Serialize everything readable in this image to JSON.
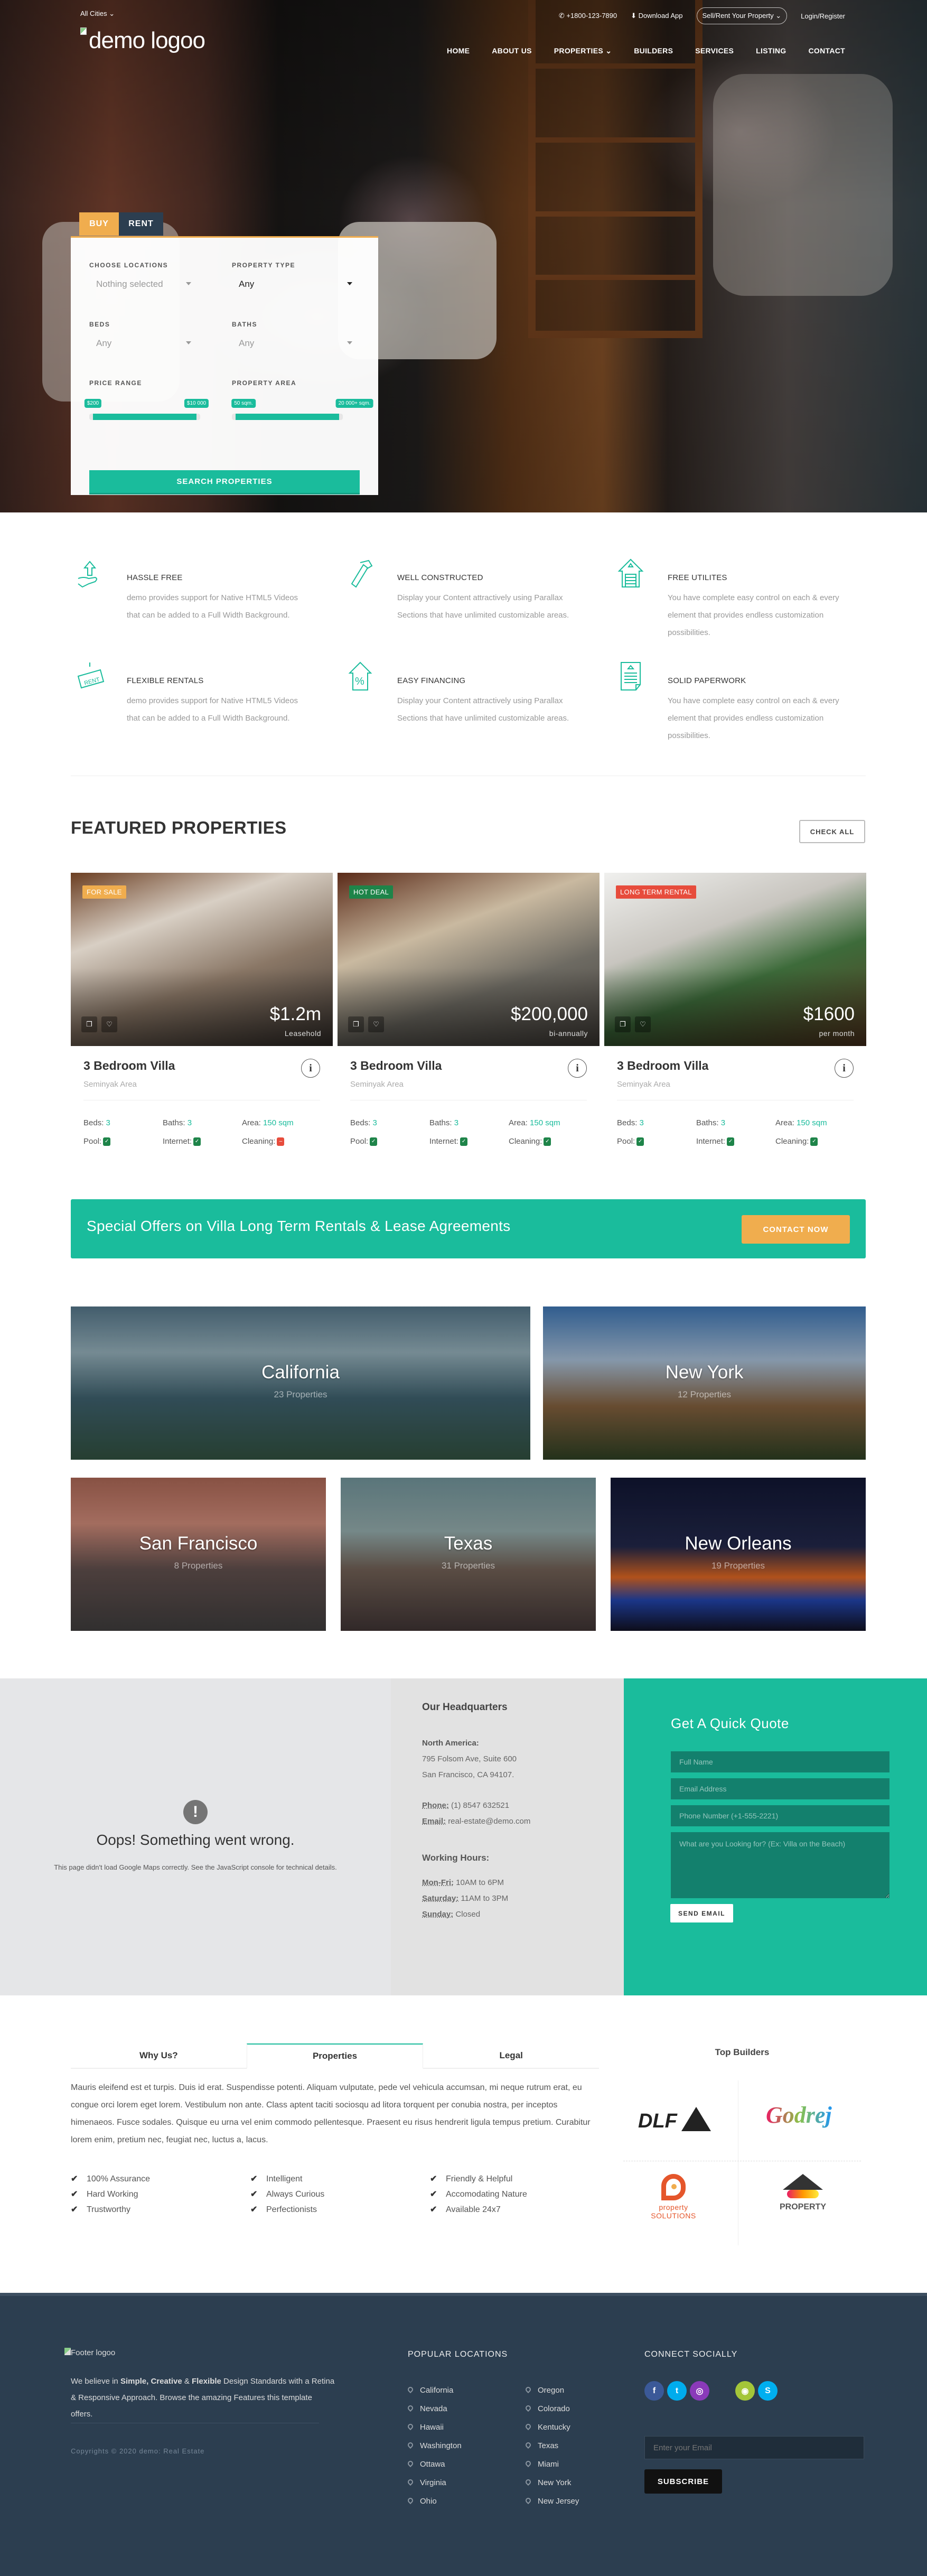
{
  "topbar": {
    "cities": "All Cities",
    "phone": "+1800-123-7890",
    "download": "Download App",
    "sell_rent": "Sell/Rent Your Property",
    "login": "Login/Register"
  },
  "logo": "demo logoo",
  "nav": [
    "HOME",
    "ABOUT US",
    "PROPERTIES",
    "BUILDERS",
    "SERVICES",
    "LISTING",
    "CONTACT"
  ],
  "search": {
    "tabs": [
      "BUY",
      "RENT"
    ],
    "active_tab": "BUY",
    "location_label": "CHOOSE LOCATIONS",
    "location_value": "Nothing selected",
    "type_label": "PROPERTY TYPE",
    "type_value": "Any",
    "beds_label": "BEDS",
    "beds_value": "Any",
    "baths_label": "BATHS",
    "baths_value": "Any",
    "price_label": "PRICE RANGE",
    "price_min": "$200",
    "price_max": "$10 000",
    "area_label": "PROPERTY AREA",
    "area_min": "50 sqm.",
    "area_max": "20 000+ sqm.",
    "button": "SEARCH PROPERTIES"
  },
  "features": [
    {
      "icon": "hand-house-icon",
      "title": "HASSLE FREE",
      "text": "demo provides support for Native HTML5 Videos that can be added to a Full Width Background."
    },
    {
      "icon": "hammer-icon",
      "title": "WELL CONSTRUCTED",
      "text": "Display your Content attractively using Parallax Sections that have unlimited customizable areas."
    },
    {
      "icon": "garage-house-icon",
      "title": "FREE UTILITES",
      "text": "You have complete easy control on each & every element that provides endless customization possibilities."
    },
    {
      "icon": "rent-sign-icon",
      "title": "FLEXIBLE RENTALS",
      "text": "demo provides support for Native HTML5 Videos that can be added to a Full Width Background."
    },
    {
      "icon": "percent-house-icon",
      "title": "EASY FINANCING",
      "text": "Display your Content attractively using Parallax Sections that have unlimited customizable areas."
    },
    {
      "icon": "document-icon",
      "title": "SOLID PAPERWORK",
      "text": "You have complete easy control on each & every element that provides endless customization possibilities."
    }
  ],
  "featured": {
    "title": "FEATURED PROPERTIES",
    "check_all": "CHECK ALL",
    "items": [
      {
        "badge": "FOR SALE",
        "badge_color": "#f0ad4e",
        "price": "$1.2m",
        "period": "Leasehold",
        "title": "3 Bedroom Villa",
        "location": "Seminyak Area",
        "beds_label": "Beds:",
        "beds": "3",
        "baths_label": "Baths:",
        "baths": "3",
        "area_label": "Area:",
        "area": "150 sqm",
        "pool_label": "Pool:",
        "pool": true,
        "internet_label": "Internet:",
        "internet": true,
        "cleaning_label": "Cleaning:",
        "cleaning": false
      },
      {
        "badge": "HOT DEAL",
        "badge_color": "#1e8449",
        "price": "$200,000",
        "period": "bi-annually",
        "title": "3 Bedroom Villa",
        "location": "Seminyak Area",
        "beds_label": "Beds:",
        "beds": "3",
        "baths_label": "Baths:",
        "baths": "3",
        "area_label": "Area:",
        "area": "150 sqm",
        "pool_label": "Pool:",
        "pool": true,
        "internet_label": "Internet:",
        "internet": true,
        "cleaning_label": "Cleaning:",
        "cleaning": true
      },
      {
        "badge": "LONG TERM RENTAL",
        "badge_color": "#e74c3c",
        "price": "$1600",
        "period": "per month",
        "title": "3 Bedroom Villa",
        "location": "Seminyak Area",
        "beds_label": "Beds:",
        "beds": "3",
        "baths_label": "Baths:",
        "baths": "3",
        "area_label": "Area:",
        "area": "150 sqm",
        "pool_label": "Pool:",
        "pool": true,
        "internet_label": "Internet:",
        "internet": true,
        "cleaning_label": "Cleaning:",
        "cleaning": true
      }
    ]
  },
  "banner": {
    "text": "Special Offers on Villa Long Term Rentals & Lease Agreements",
    "button": "CONTACT NOW"
  },
  "cities": [
    {
      "name": "California",
      "count": "23 Properties"
    },
    {
      "name": "New York",
      "count": "12 Properties"
    },
    {
      "name": "San Francisco",
      "count": "8 Properties"
    },
    {
      "name": "Texas",
      "count": "31 Properties"
    },
    {
      "name": "New Orleans",
      "count": "19 Properties"
    }
  ],
  "map": {
    "title": "Oops! Something went wrong.",
    "message": "This page didn't load Google Maps correctly. See the JavaScript console for technical details."
  },
  "hq": {
    "title": "Our Headquarters",
    "region": "North America:",
    "address1": "795 Folsom Ave, Suite 600",
    "address2": "San Francisco, CA 94107.",
    "phone_label": "Phone:",
    "phone": "(1) 8547 632521",
    "email_label": "Email:",
    "email": "real-estate@demo.com",
    "hours_title": "Working Hours:",
    "hours": [
      {
        "day": "Mon-Fri:",
        "time": "10AM to 6PM"
      },
      {
        "day": "Saturday:",
        "time": "11AM to 3PM"
      },
      {
        "day": "Sunday:",
        "time": "Closed"
      }
    ]
  },
  "quote": {
    "title": "Get A Quick Quote",
    "name_placeholder": "Full Name",
    "email_placeholder": "Email Address",
    "phone_placeholder": "Phone Number (+1-555-2221)",
    "message_placeholder": "What are you Looking for? (Ex: Villa on the Beach)",
    "button": "SEND EMAIL"
  },
  "about": {
    "tabs": [
      "Why Us?",
      "Properties",
      "Legal"
    ],
    "active_tab": "Properties",
    "text": "Mauris eleifend est et turpis. Duis id erat. Suspendisse potenti. Aliquam vulputate, pede vel vehicula accumsan, mi neque rutrum erat, eu congue orci lorem eget lorem. Vestibulum non ante. Class aptent taciti sociosqu ad litora torquent per conubia nostra, per inceptos himenaeos. Fusce sodales. Quisque eu urna vel enim commodo pellentesque. Praesent eu risus hendrerit ligula tempus pretium. Curabitur lorem enim, pretium nec, feugiat nec, luctus a, lacus.",
    "ticks": [
      [
        "100% Assurance",
        "Hard Working",
        "Trustworthy"
      ],
      [
        "Intelligent",
        "Always Curious",
        "Perfectionists"
      ],
      [
        "Friendly & Helpful",
        "Accomodating Nature",
        "Available 24x7"
      ]
    ]
  },
  "builders": {
    "title": "Top Builders",
    "logos": [
      "DLF",
      "Godrej",
      "property SOLUTIONS",
      "PROPERTY"
    ]
  },
  "footer": {
    "logo_alt": "Footer logoo",
    "about_pre": "We believe in ",
    "about_bold1": "Simple, Creative",
    "about_mid": " & ",
    "about_bold2": "Flexible",
    "about_post": " Design Standards with a Retina & Responsive Approach. Browse the amazing Features this template offers.",
    "copyright": "Copyrights © 2020 demo: Real Estate",
    "locations_title": "POPULAR LOCATIONS",
    "locations_col1": [
      "California",
      "Nevada",
      "Hawaii",
      "Washington",
      "Ottawa",
      "Virginia",
      "Ohio"
    ],
    "locations_col2": [
      "Oregon",
      "Colorado",
      "Kentucky",
      "Texas",
      "Miami",
      "New York",
      "New Jersey"
    ],
    "social_title": "CONNECT SOCIALLY",
    "social": [
      {
        "name": "facebook",
        "glyph": "f",
        "color": "#3b5998"
      },
      {
        "name": "twitter",
        "glyph": "t",
        "color": "#00aced"
      },
      {
        "name": "instagram",
        "glyph": "◎",
        "color": "#8a3ab9"
      },
      {
        "name": "apple",
        "glyph": "",
        "color": "transparent"
      },
      {
        "name": "android",
        "glyph": "◉",
        "color": "#a4c639"
      },
      {
        "name": "skype",
        "glyph": "S",
        "color": "#00aff0"
      }
    ],
    "email_placeholder": "Enter your Email",
    "subscribe": "SUBSCRIBE"
  }
}
